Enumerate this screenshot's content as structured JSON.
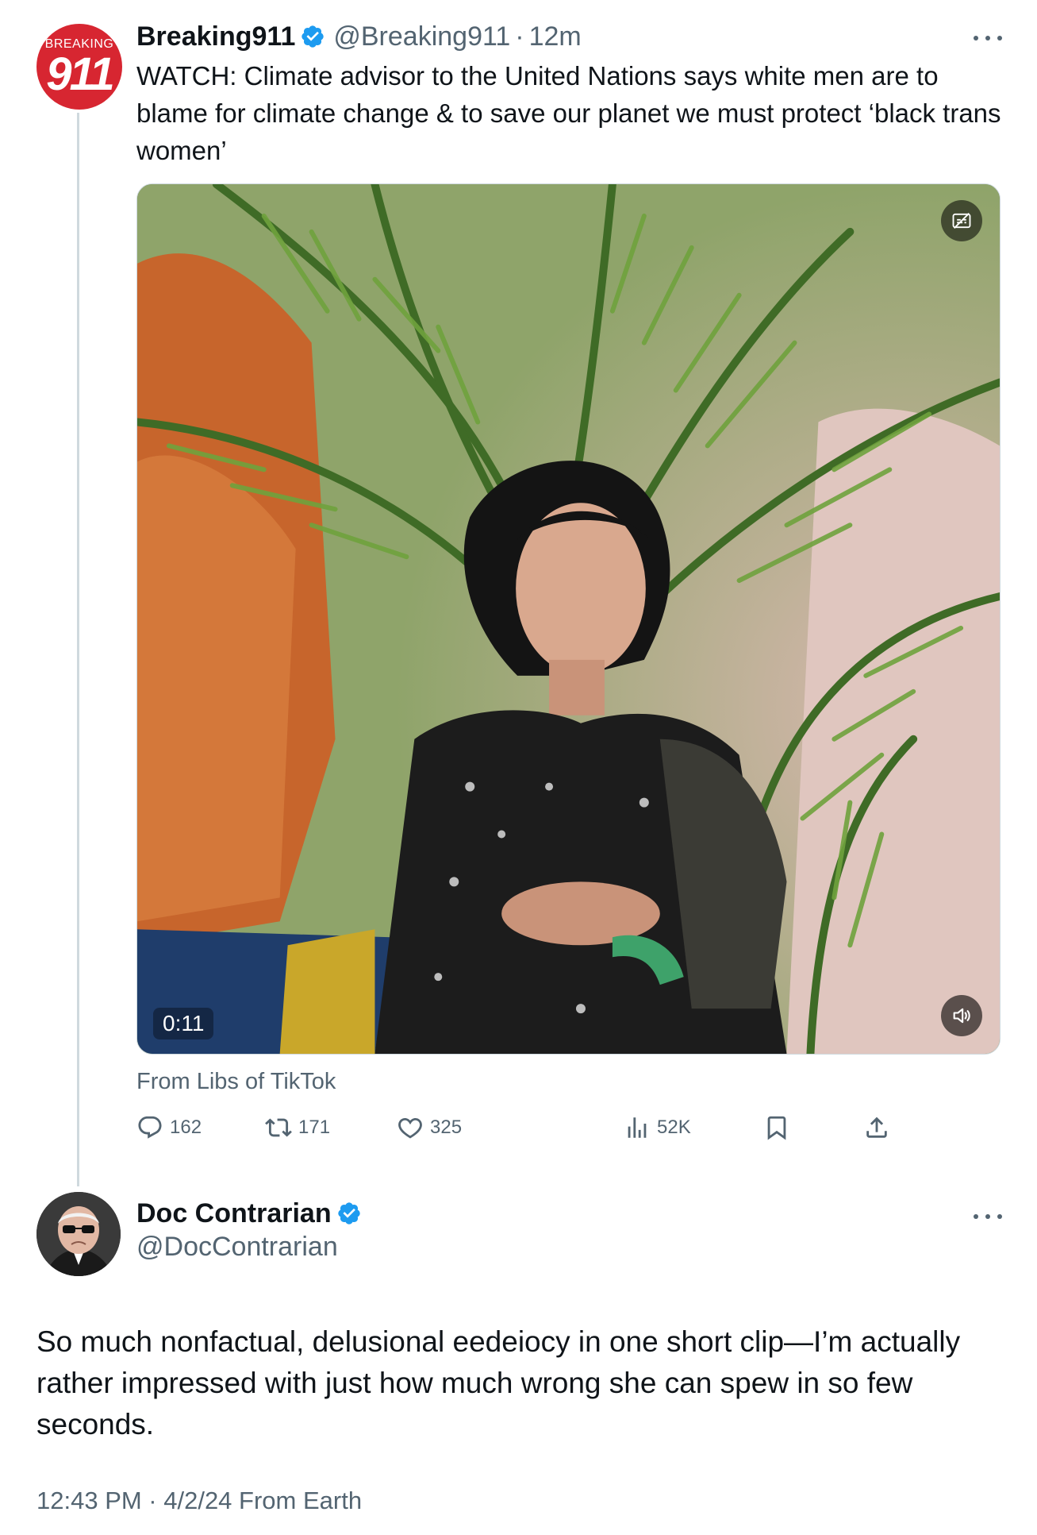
{
  "tweet": {
    "avatar": {
      "top_text": "BREAKING",
      "main_text": "911",
      "color": "#d72631"
    },
    "author_name": "Breaking911",
    "handle": "@Breaking911",
    "separator": "·",
    "time": "12m",
    "text": "WATCH: Climate advisor to the United Nations says white men are to blame for climate change & to save our planet we must protect ‘black trans women’",
    "media": {
      "duration": "0:11",
      "captions_icon": "captions-icon",
      "volume_icon": "volume-icon"
    },
    "source_label": "From Libs of TikTok",
    "stats": {
      "replies": "162",
      "reposts": "171",
      "likes": "325",
      "views": "52K"
    },
    "icons": [
      "reply-icon",
      "repost-icon",
      "like-icon",
      "views-icon",
      "bookmark-icon",
      "share-icon"
    ]
  },
  "reply": {
    "author_name": "Doc Contrarian",
    "handle": "@DocContrarian",
    "text": "So much nonfactual, delusional eedeiocy in one short clip—I’m actually rather impressed with just how much wrong she can spew in so few seconds.",
    "timestamp": "12:43 PM · 4/2/24 From Earth"
  },
  "colors": {
    "verified": "#1d9bf0",
    "secondary_text": "#536471",
    "primary_text": "#0f1419",
    "thread_line": "#cfd9de"
  }
}
